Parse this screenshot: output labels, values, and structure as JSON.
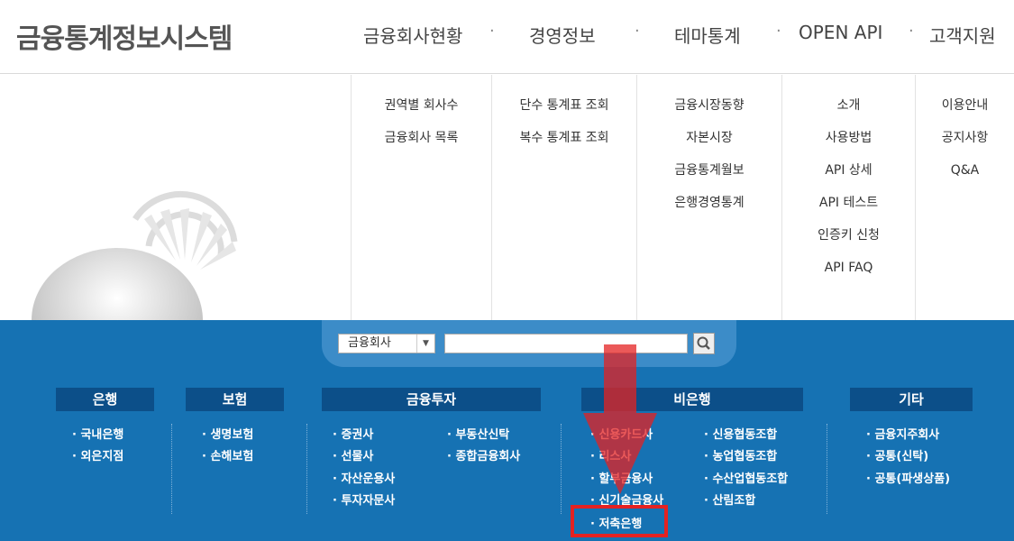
{
  "header": {
    "logo": "금융통계정보시스템",
    "nav": [
      "금융회사현황",
      "경영정보",
      "테마통계",
      "OPEN API",
      "고객지원"
    ],
    "separator": "·"
  },
  "submenu": {
    "col1": [
      "권역별 회사수",
      "금융회사 목록"
    ],
    "col2": [
      "단수 통계표 조회",
      "복수 통계표 조회"
    ],
    "col3": [
      "금융시장동향",
      "자본시장",
      "금융통계월보",
      "은행경영통계"
    ],
    "col4": [
      "소개",
      "사용방법",
      "API 상세",
      "API 테스트",
      "인증키 신청",
      "API FAQ"
    ],
    "col5": [
      "이용안내",
      "공지사항",
      "Q&A"
    ]
  },
  "search": {
    "select_value": "금융회사",
    "input_value": "",
    "button_icon": "search-icon"
  },
  "categories": {
    "bank": {
      "title": "은행",
      "items": [
        "· 국내은행",
        "· 외은지점"
      ]
    },
    "insurance": {
      "title": "보험",
      "items": [
        "· 생명보험",
        "· 손해보험"
      ]
    },
    "investment": {
      "title": "금융투자",
      "left": [
        "· 증권사",
        "· 선물사",
        "· 자산운용사",
        "· 투자자문사"
      ],
      "right": [
        "· 부동산신탁",
        "· 종합금융회사"
      ]
    },
    "nonbank": {
      "title": "비은행",
      "left": [
        "· 신용카드사",
        "· 리스사",
        "· 할부금융사",
        "· 신기술금융사",
        "· 저축은행"
      ],
      "right": [
        "· 신용협동조합",
        "· 농업협동조합",
        "· 수산업협동조합",
        "· 산림조합"
      ]
    },
    "etc": {
      "title": "기타",
      "items": [
        "· 금융지주회사",
        "· 공통(신탁)",
        "· 공통(파생상품)"
      ]
    }
  },
  "colors": {
    "panel_blue": "#1672b3",
    "header_dark_blue": "#0c4f89",
    "highlight_red": "#e42222"
  }
}
